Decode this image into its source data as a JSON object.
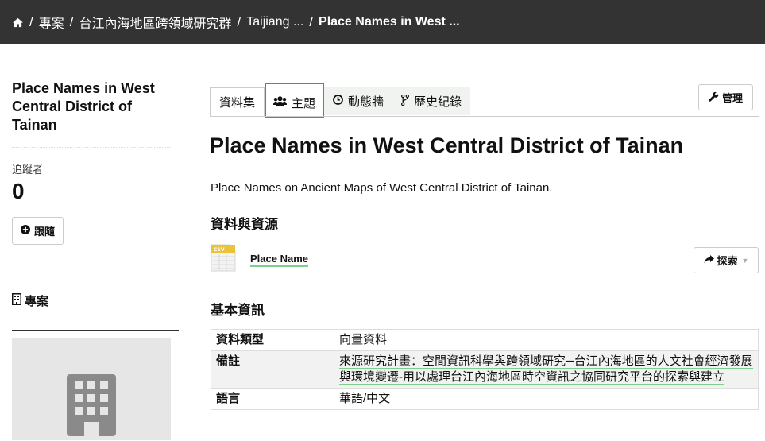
{
  "breadcrumb": {
    "home_icon": "home-icon",
    "items": [
      "專案",
      "台江內海地區跨領域研究群",
      "Taijiang ...",
      "Place Names in West ..."
    ],
    "separator": "/"
  },
  "sidebar": {
    "title": "Place Names in West Central District of Tainan",
    "followers_label": "追蹤者",
    "followers_count": "0",
    "follow_button": "跟隨",
    "project_label": "專案"
  },
  "tabs": [
    {
      "label": "資料集",
      "icon": null
    },
    {
      "label": "主題",
      "icon": "users-icon"
    },
    {
      "label": "動態牆",
      "icon": "clock-icon"
    },
    {
      "label": "歷史紀錄",
      "icon": "branch-icon"
    }
  ],
  "manage_button": "管理",
  "main": {
    "title": "Place Names in West Central District of Tainan",
    "description": "Place Names on Ancient Maps of West Central District of Tainan.",
    "resources_heading": "資料與資源",
    "resource": {
      "format": "CSV",
      "name": "Place Name"
    },
    "explore_button": "探索",
    "info_heading": "基本資訊",
    "info_rows": [
      {
        "key": "資料類型",
        "value": "向量資料"
      },
      {
        "key": "備註",
        "value": "來源研究計畫：空間資訊科學與跨領域研究─台江內海地區的人文社會經濟發展與環境變遷-用以處理台江內海地區時空資訊之協同研究平台的探索與建立"
      },
      {
        "key": "語言",
        "value": "華語/中文"
      }
    ]
  },
  "colors": {
    "topbar": "#333333",
    "highlight": "#d6563c",
    "link_underline": "#7bd08b",
    "tab_bg": "#f0f3ef"
  }
}
